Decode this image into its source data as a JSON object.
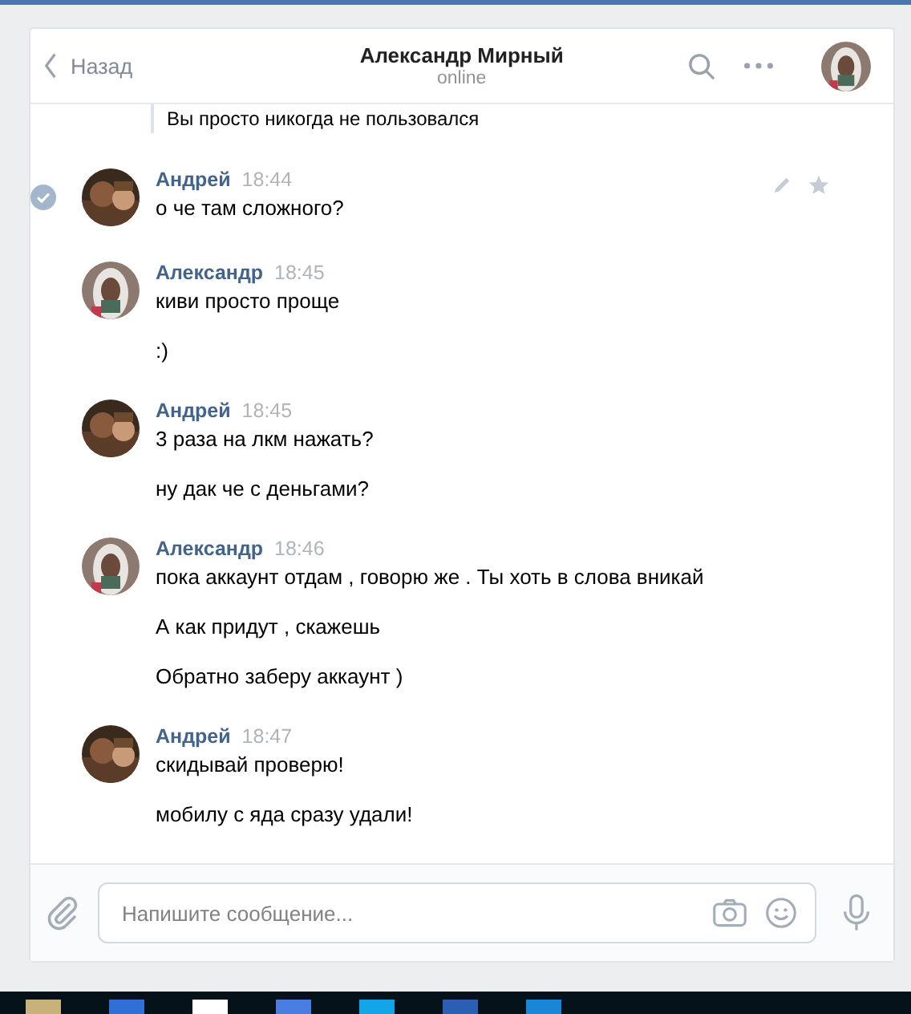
{
  "header": {
    "back": "Назад",
    "title": "Александр Мирный",
    "status": "online"
  },
  "quote": "Вы просто никогда не пользовался",
  "messages": [
    {
      "author": "Андрей",
      "time": "18:44",
      "selected": true,
      "hovered": true,
      "kind": "outgoing",
      "texts": [
        "о че там сложного?"
      ]
    },
    {
      "author": "Александр",
      "time": "18:45",
      "selected": false,
      "hovered": false,
      "kind": "incoming",
      "texts": [
        "киви просто проще",
        ":)"
      ]
    },
    {
      "author": "Андрей",
      "time": "18:45",
      "selected": false,
      "hovered": false,
      "kind": "outgoing",
      "texts": [
        "3 раза на лкм нажать?",
        "ну дак че с деньгами?"
      ]
    },
    {
      "author": "Александр",
      "time": "18:46",
      "selected": false,
      "hovered": false,
      "kind": "incoming",
      "texts": [
        "пока аккаунт отдам , говорю же . Ты хоть в слова вникай",
        "А как придут , скажешь",
        "Обратно заберу аккаунт )"
      ]
    },
    {
      "author": "Андрей",
      "time": "18:47",
      "selected": false,
      "hovered": false,
      "kind": "outgoing",
      "texts": [
        "скидывай проверю!",
        "мобилу с яда сразу удали!"
      ]
    }
  ],
  "composer": {
    "placeholder": "Напишите сообщение..."
  },
  "taskbar": [
    {
      "color": "#c9b27a"
    },
    {
      "color": "#2f6fd6"
    },
    {
      "color": "#ffffff"
    },
    {
      "color": "#4a7de0"
    },
    {
      "color": "#12a5e8"
    },
    {
      "color": "#2b5fb3"
    },
    {
      "color": "#1a86d8"
    }
  ]
}
